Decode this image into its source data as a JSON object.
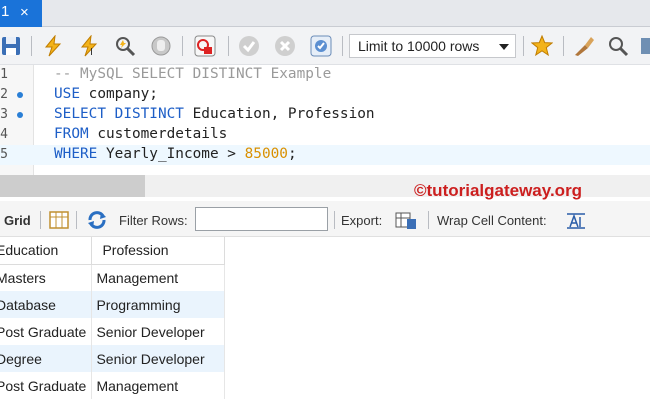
{
  "tab": {
    "label": "1",
    "close": "×"
  },
  "toolbar": {
    "limit": "Limit to 10000 rows",
    "icons": [
      "save-icon",
      "execute-icon",
      "execute-current-icon",
      "explain-icon",
      "stop-icon",
      "toggle-error-icon",
      "commit-icon",
      "rollback-icon",
      "autocommit-icon",
      "bookmark-star-icon",
      "beautify-icon",
      "find-icon"
    ]
  },
  "editor": {
    "lines": [
      {
        "num": "1",
        "tokens": [
          {
            "t": "-- MySQL SELECT DISTINCT Example",
            "c": "cmt"
          }
        ]
      },
      {
        "num": "2",
        "tokens": [
          {
            "t": "USE",
            "c": "kw"
          },
          {
            "t": " company;",
            "c": ""
          }
        ]
      },
      {
        "num": "3",
        "tokens": [
          {
            "t": "SELECT",
            "c": "kw"
          },
          {
            "t": " ",
            "c": ""
          },
          {
            "t": "DISTINCT",
            "c": "kw"
          },
          {
            "t": " Education, Profession",
            "c": ""
          }
        ]
      },
      {
        "num": "4",
        "tokens": [
          {
            "t": "FROM",
            "c": "kw"
          },
          {
            "t": " customerdetails",
            "c": ""
          }
        ]
      },
      {
        "num": "5",
        "tokens": [
          {
            "t": "WHERE",
            "c": "kw"
          },
          {
            "t": " Yearly_Income > ",
            "c": ""
          },
          {
            "t": "85000",
            "c": "num"
          },
          {
            "t": ";",
            "c": ""
          }
        ]
      }
    ]
  },
  "watermark": "©tutorialgateway.org",
  "results_toolbar": {
    "grid_label": "Grid",
    "filter_label": "Filter Rows:",
    "filter_value": "",
    "export_label": "Export:",
    "wrap_label": "Wrap Cell Content:"
  },
  "grid": {
    "columns": [
      "Education",
      "Profession"
    ],
    "rows": [
      [
        "Masters",
        "Management"
      ],
      [
        "Database",
        "Programming"
      ],
      [
        "Post Graduate",
        "Senior Developer"
      ],
      [
        "Degree",
        "Senior Developer"
      ],
      [
        "Post Graduate",
        "Management"
      ]
    ]
  },
  "colors": {
    "tab": "#1a73d9",
    "keyword": "#1d5ec7",
    "number": "#d99000",
    "comment": "#9a9a9a",
    "watermark": "#cc1f1f",
    "alt_row": "#eaf4fd"
  }
}
